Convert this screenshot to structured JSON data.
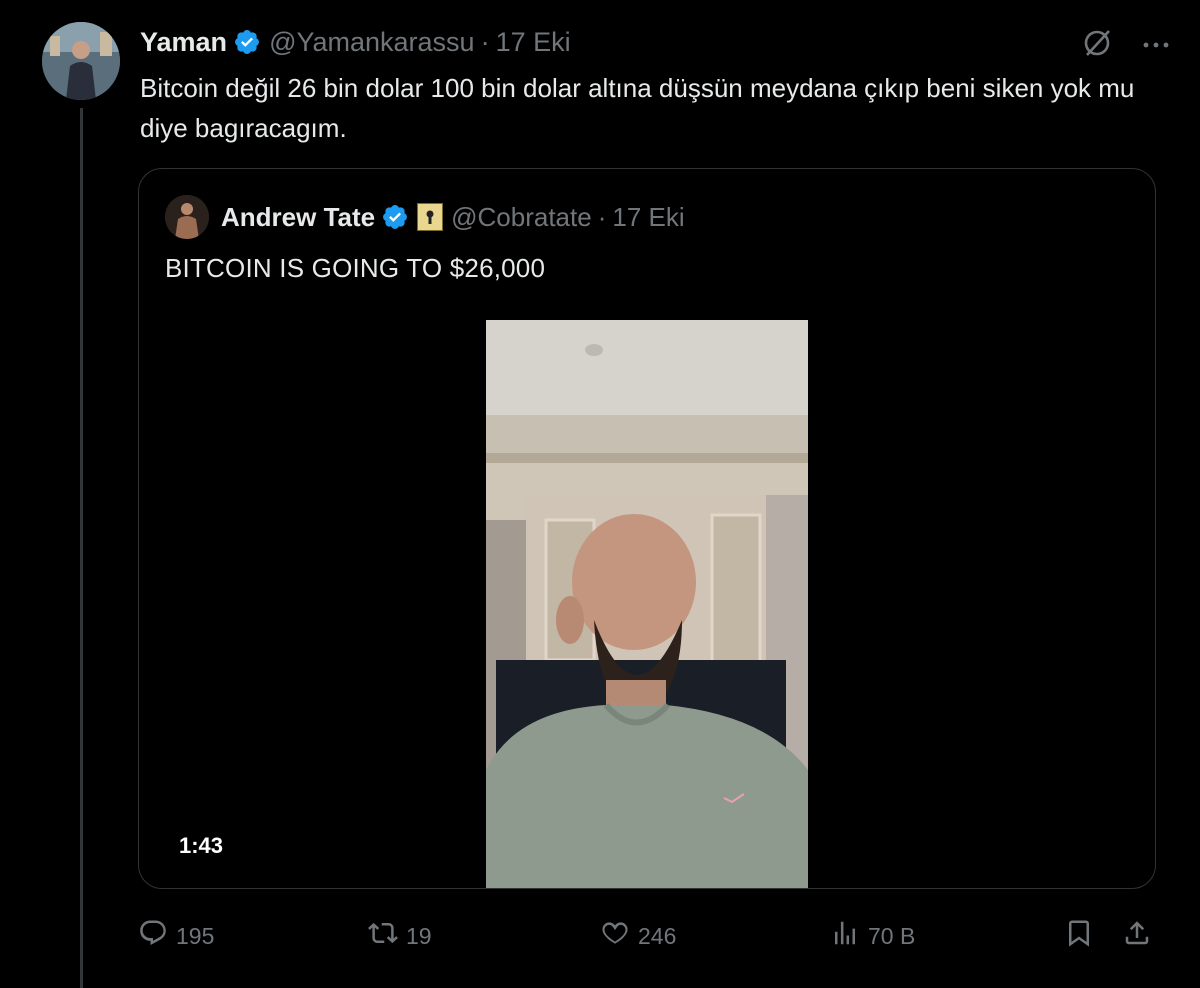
{
  "tweet": {
    "author_name": "Yaman",
    "handle": "@Yamankarassu",
    "separator": "·",
    "date": "17 Eki",
    "text": "Bitcoin değil 26 bin dolar 100 bin dolar altına düşsün meydana çıkıp beni siken yok mu diye bagıracagım."
  },
  "quote": {
    "author_name": "Andrew Tate",
    "handle": "@Cobratate",
    "separator": "·",
    "date": "17 Eki",
    "text": "BITCOIN IS GOING TO $26,000",
    "video_duration": "1:43"
  },
  "actions": {
    "replies": "195",
    "reposts": "19",
    "likes": "246",
    "views": "70 B"
  },
  "icons": {
    "verified": "verified-badge-icon",
    "grok": "grok-icon",
    "more": "more-icon",
    "reply": "reply-icon",
    "repost": "repost-icon",
    "like": "heart-icon",
    "views": "views-icon",
    "bookmark": "bookmark-icon",
    "share": "share-icon"
  },
  "colors": {
    "background": "#000000",
    "text": "#e7e9ea",
    "muted": "#71767b",
    "verified": "#1d9bf0",
    "border": "#2f3336"
  }
}
